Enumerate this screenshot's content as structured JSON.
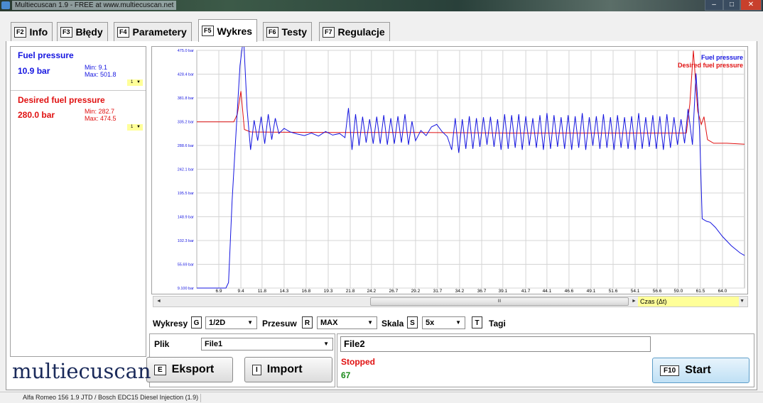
{
  "window": {
    "title": "Multiecuscan 1.9 - FREE at www.multiecuscan.net",
    "min": "–",
    "max": "□",
    "close": "✕"
  },
  "tabs": [
    {
      "key": "F2",
      "label": "Info"
    },
    {
      "key": "F3",
      "label": "Błędy"
    },
    {
      "key": "F4",
      "label": "Parametery"
    },
    {
      "key": "F5",
      "label": "Wykres"
    },
    {
      "key": "F6",
      "label": "Testy"
    },
    {
      "key": "F7",
      "label": "Regulacje"
    }
  ],
  "params": [
    {
      "name": "Fuel pressure",
      "value": "10.9 bar",
      "min": "Min: 9.1",
      "max": "Max: 501.8",
      "scale": "1",
      "color": "#1515e0"
    },
    {
      "name": "Desired fuel pressure",
      "value": "280.0 bar",
      "min": "Min: 282.7",
      "max": "Max: 474.5",
      "scale": "1",
      "color": "#e01010"
    }
  ],
  "chart_data": {
    "type": "line",
    "y_ticks": [
      "9.100 bar",
      "55.69 bar",
      "102.3 bar",
      "148.9 bar",
      "195.5 bar",
      "242.1 bar",
      "288.6 bar",
      "335.2 bar",
      "381.8 bar",
      "428.4 bar",
      "475.0 bar"
    ],
    "x_ticks": [
      "6.9",
      "9.4",
      "11.8",
      "14.3",
      "16.8",
      "19.3",
      "21.8",
      "24.2",
      "26.7",
      "29.2",
      "31.7",
      "34.2",
      "36.7",
      "39.1",
      "41.7",
      "44.1",
      "46.6",
      "49.1",
      "51.6",
      "54.1",
      "56.6",
      "59.0",
      "61.5",
      "64.0"
    ],
    "ylim": [
      9.1,
      475.0
    ],
    "xlim": [
      4.4,
      66.5
    ],
    "legend": "top-right",
    "grid": true,
    "series": [
      {
        "name": "Fuel pressure",
        "color": "#1515e0",
        "points": [
          [
            4.4,
            9.1
          ],
          [
            7.7,
            9.1
          ],
          [
            8.0,
            20
          ],
          [
            8.4,
            180
          ],
          [
            8.9,
            330
          ],
          [
            9.3,
            445
          ],
          [
            9.7,
            501.8
          ],
          [
            10.1,
            360
          ],
          [
            10.5,
            280
          ],
          [
            10.9,
            338
          ],
          [
            11.3,
            298
          ],
          [
            11.7,
            345
          ],
          [
            12.1,
            292
          ],
          [
            12.5,
            350
          ],
          [
            12.9,
            300
          ],
          [
            13.3,
            342
          ],
          [
            13.7,
            312
          ],
          [
            14.3,
            322
          ],
          [
            15.0,
            315
          ],
          [
            15.8,
            311
          ],
          [
            16.6,
            308
          ],
          [
            17.4,
            313
          ],
          [
            18.2,
            307
          ],
          [
            19.0,
            316
          ],
          [
            19.8,
            309
          ],
          [
            20.6,
            312
          ],
          [
            21.2,
            304
          ],
          [
            21.6,
            362
          ],
          [
            22.0,
            280
          ],
          [
            22.4,
            350
          ],
          [
            22.8,
            288
          ],
          [
            23.2,
            345
          ],
          [
            23.6,
            294
          ],
          [
            24.0,
            340
          ],
          [
            24.4,
            292
          ],
          [
            24.8,
            345
          ],
          [
            25.2,
            292
          ],
          [
            25.6,
            348
          ],
          [
            26.0,
            290
          ],
          [
            26.4,
            342
          ],
          [
            26.8,
            292
          ],
          [
            27.2,
            346
          ],
          [
            27.6,
            294
          ],
          [
            28.0,
            350
          ],
          [
            28.4,
            290
          ],
          [
            28.8,
            336
          ],
          [
            29.2,
            298
          ],
          [
            29.8,
            318
          ],
          [
            30.4,
            308
          ],
          [
            31.0,
            325
          ],
          [
            31.6,
            330
          ],
          [
            32.2,
            316
          ],
          [
            32.8,
            306
          ],
          [
            33.3,
            280
          ],
          [
            33.7,
            342
          ],
          [
            34.1,
            274
          ],
          [
            34.5,
            340
          ],
          [
            34.9,
            282
          ],
          [
            35.3,
            346
          ],
          [
            35.7,
            282
          ],
          [
            36.1,
            342
          ],
          [
            36.5,
            286
          ],
          [
            36.9,
            344
          ],
          [
            37.3,
            290
          ],
          [
            37.7,
            345
          ],
          [
            38.1,
            286
          ],
          [
            38.5,
            340
          ],
          [
            38.9,
            280
          ],
          [
            39.3,
            350
          ],
          [
            39.7,
            282
          ],
          [
            40.1,
            348
          ],
          [
            40.5,
            284
          ],
          [
            40.9,
            350
          ],
          [
            41.3,
            280
          ],
          [
            41.7,
            346
          ],
          [
            42.1,
            288
          ],
          [
            42.5,
            342
          ],
          [
            42.9,
            284
          ],
          [
            43.3,
            348
          ],
          [
            43.7,
            280
          ],
          [
            44.1,
            352
          ],
          [
            44.5,
            282
          ],
          [
            44.9,
            348
          ],
          [
            45.3,
            286
          ],
          [
            45.7,
            344
          ],
          [
            46.1,
            282
          ],
          [
            46.5,
            348
          ],
          [
            46.9,
            280
          ],
          [
            47.3,
            346
          ],
          [
            47.7,
            284
          ],
          [
            48.1,
            352
          ],
          [
            48.5,
            280
          ],
          [
            48.9,
            344
          ],
          [
            49.3,
            288
          ],
          [
            49.7,
            346
          ],
          [
            50.1,
            282
          ],
          [
            50.5,
            350
          ],
          [
            50.9,
            284
          ],
          [
            51.3,
            344
          ],
          [
            51.7,
            280
          ],
          [
            52.1,
            348
          ],
          [
            52.5,
            284
          ],
          [
            52.9,
            344
          ],
          [
            53.3,
            282
          ],
          [
            53.7,
            346
          ],
          [
            54.1,
            280
          ],
          [
            54.5,
            352
          ],
          [
            54.9,
            282
          ],
          [
            55.3,
            344
          ],
          [
            55.7,
            286
          ],
          [
            56.1,
            348
          ],
          [
            56.5,
            282
          ],
          [
            56.9,
            346
          ],
          [
            57.3,
            280
          ],
          [
            57.7,
            350
          ],
          [
            58.1,
            284
          ],
          [
            58.5,
            344
          ],
          [
            58.9,
            290
          ],
          [
            59.3,
            340
          ],
          [
            59.7,
            293
          ],
          [
            60.1,
            360
          ],
          [
            60.6,
            290
          ],
          [
            61.0,
            430
          ],
          [
            61.4,
            320
          ],
          [
            61.7,
            145
          ],
          [
            62.2,
            140
          ],
          [
            62.6,
            138
          ],
          [
            63.2,
            128
          ],
          [
            64.0,
            110
          ],
          [
            65.0,
            92
          ],
          [
            66.0,
            78
          ],
          [
            66.5,
            73
          ]
        ]
      },
      {
        "name": "Desired fuel pressure",
        "color": "#e01010",
        "points": [
          [
            4.4,
            335
          ],
          [
            8.6,
            335
          ],
          [
            9.0,
            350
          ],
          [
            9.4,
            395
          ],
          [
            9.8,
            320
          ],
          [
            10.5,
            315
          ],
          [
            20,
            314
          ],
          [
            30,
            314
          ],
          [
            40,
            313
          ],
          [
            50,
            313
          ],
          [
            59.9,
            313
          ],
          [
            60.3,
            370
          ],
          [
            60.7,
            474.5
          ],
          [
            61.2,
            355
          ],
          [
            61.6,
            330
          ],
          [
            61.9,
            345
          ],
          [
            62.3,
            300
          ],
          [
            63.0,
            293
          ],
          [
            64.5,
            293
          ],
          [
            66.5,
            291
          ]
        ]
      }
    ]
  },
  "scroll": {
    "thumb": "III",
    "time_axis": "Czas (Δt)"
  },
  "controls": {
    "wykresy_label": "Wykresy",
    "wykresy_key": "G",
    "wykresy_value": "1/2D",
    "przesuw_label": "Przesuw",
    "przesuw_key": "R",
    "przesuw_value": "MAX",
    "skala_label": "Skala",
    "skala_key": "S",
    "skala_value": "5x",
    "tagi_key": "T",
    "tagi_label": "Tagi"
  },
  "file": {
    "label": "Plik",
    "value": "File1",
    "name_field": "File2"
  },
  "buttons": {
    "export_key": "E",
    "export_label": "Eksport",
    "import_key": "I",
    "import_label": "Import",
    "start_key": "F10",
    "start_label": "Start"
  },
  "status": {
    "state": "Stopped",
    "count": "67",
    "state_color": "#e01010",
    "count_color": "#1a8a1a"
  },
  "logo": "multiecuscan",
  "statusbar": {
    "vehicle": "Alfa Romeo 156 1.9 JTD / Bosch EDC15 Diesel Injection (1.9)"
  }
}
